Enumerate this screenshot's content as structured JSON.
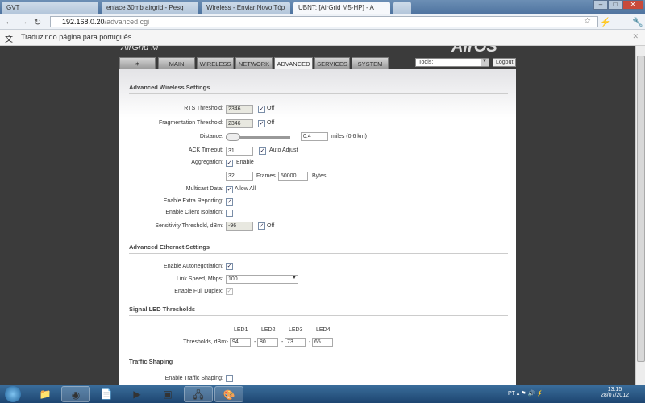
{
  "browser": {
    "tabs": [
      "GVT",
      "enlace 30mb airgrid - Pesq",
      "Wireless - Enviar Novo Tóp",
      "UBNT: [AirGrid M5-HP] - A"
    ],
    "url_host": "192.168.0.20",
    "url_path": "/advanced.cgi",
    "translate_message": "Traduzindo página para português..."
  },
  "header": {
    "logo": "AirGrid M",
    "product": "AirOS",
    "tabs": [
      "MAIN",
      "WIRELESS",
      "NETWORK",
      "ADVANCED",
      "SERVICES",
      "SYSTEM"
    ],
    "tools_label": "Tools:",
    "logout_label": "Logout"
  },
  "wireless": {
    "title": "Advanced Wireless Settings",
    "rts_label": "RTS Threshold:",
    "rts_value": "2346",
    "off": "Off",
    "frag_label": "Fragmentation Threshold:",
    "frag_value": "2346",
    "distance_label": "Distance:",
    "distance_value": "0.4",
    "distance_unit": "miles (0.6 km)",
    "ack_label": "ACK Timeout:",
    "ack_value": "31",
    "auto_adjust": "Auto Adjust",
    "agg_label": "Aggregation:",
    "enable": "Enable",
    "frames_value": "32",
    "frames": "Frames",
    "bytes_value": "50000",
    "bytes": "Bytes",
    "multicast_label": "Multicast Data:",
    "allow_all": "Allow All",
    "extra_label": "Enable Extra Reporting:",
    "isolation_label": "Enable Client Isolation:",
    "sens_label": "Sensitivity Threshold, dBm:",
    "sens_value": "-96"
  },
  "ethernet": {
    "title": "Advanced Ethernet Settings",
    "autoneg_label": "Enable Autonegotiation:",
    "speed_label": "Link Speed, Mbps:",
    "speed_value": "100",
    "duplex_label": "Enable Full Duplex:"
  },
  "led": {
    "title": "Signal LED Thresholds",
    "thresholds_label": "Thresholds, dBm:",
    "leds": [
      {
        "name": "LED1",
        "value": "94"
      },
      {
        "name": "LED2",
        "value": "80"
      },
      {
        "name": "LED3",
        "value": "73"
      },
      {
        "name": "LED4",
        "value": "65"
      }
    ],
    "minus": "-"
  },
  "traffic": {
    "title": "Traffic Shaping",
    "enable_label": "Enable Traffic Shaping:"
  },
  "taskbar": {
    "lang": "PT",
    "time": "13:15",
    "date": "28/07/2012"
  }
}
